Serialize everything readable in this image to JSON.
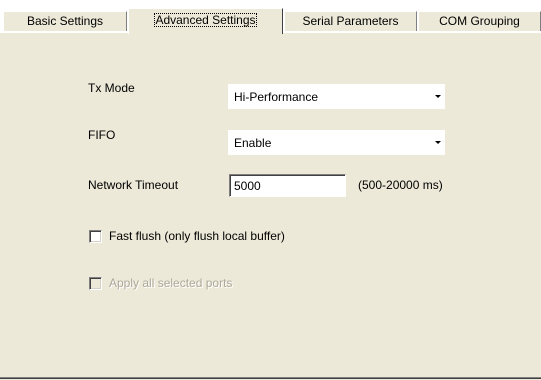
{
  "tabs": [
    {
      "label": "Basic Settings",
      "active": false
    },
    {
      "label": "Advanced Settings",
      "active": true
    },
    {
      "label": "Serial Parameters",
      "active": false
    },
    {
      "label": "COM Grouping",
      "active": false
    }
  ],
  "form": {
    "tx_mode": {
      "label": "Tx Mode",
      "value": "Hi-Performance"
    },
    "fifo": {
      "label": "FIFO",
      "value": "Enable"
    },
    "network_timeout": {
      "label": "Network Timeout",
      "value": "5000",
      "range_hint": "(500-20000 ms)"
    },
    "fast_flush": {
      "label": "Fast flush (only flush local buffer)",
      "checked": false
    },
    "apply_all": {
      "label": "Apply all selected ports",
      "checked": false,
      "enabled": false
    }
  },
  "colors": {
    "panel_background": "#ece9d8",
    "disabled_text": "#aca899"
  },
  "icons": {
    "combo_arrow": "chevron-down-icon"
  }
}
